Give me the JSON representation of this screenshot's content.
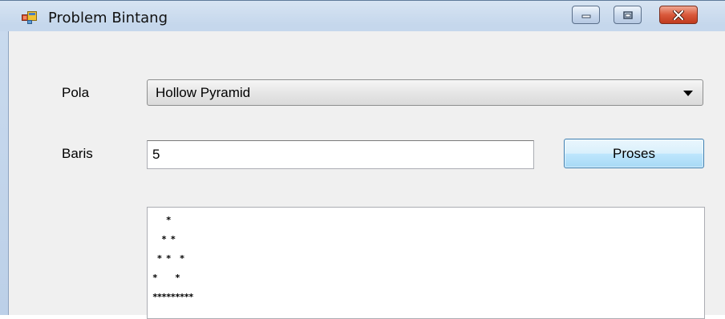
{
  "window": {
    "title": "Problem Bintang",
    "icons": {
      "app": "app-window-icon",
      "minimize": "minimize-icon",
      "maximize": "maximize-icon",
      "close": "close-icon"
    }
  },
  "form": {
    "pola_label": "Pola",
    "pola_selected": "Hollow Pyramid",
    "baris_label": "Baris",
    "baris_value": "5",
    "proses_label": "Proses",
    "output_text": "   *\n  * *\n * *  *\n*    *\n*********"
  }
}
